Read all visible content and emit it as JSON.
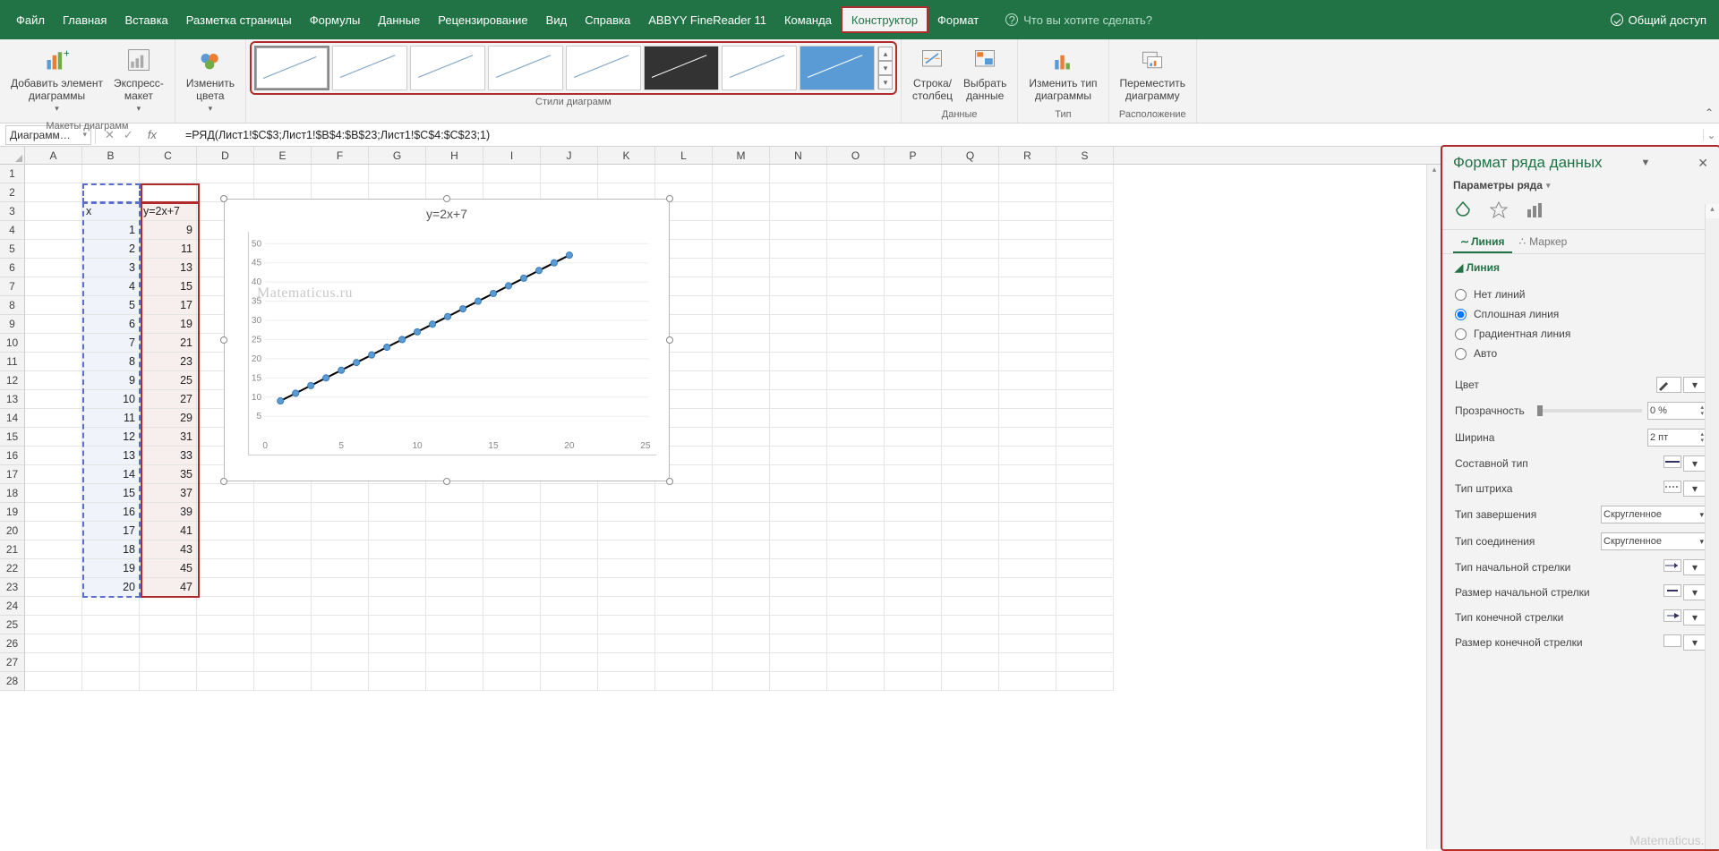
{
  "titlebar": {
    "tabs": [
      "Файл",
      "Главная",
      "Вставка",
      "Разметка страницы",
      "Формулы",
      "Данные",
      "Рецензирование",
      "Вид",
      "Справка",
      "ABBYY FineReader 11",
      "Команда",
      "Конструктор",
      "Формат"
    ],
    "active_tab_index": 11,
    "tell_me": "Что вы хотите сделать?",
    "share": "Общий доступ"
  },
  "ribbon": {
    "grp_layouts": "Макеты диаграмм",
    "add_element": "Добавить элемент\nдиаграммы",
    "quick_layout": "Экспресс-\nмакет",
    "change_colors": "Изменить\nцвета",
    "grp_styles": "Стили диаграмм",
    "grp_data": "Данные",
    "switch_rc": "Строка/\nстолбец",
    "select_data": "Выбрать\nданные",
    "grp_type": "Тип",
    "change_type": "Изменить тип\nдиаграммы",
    "grp_location": "Расположение",
    "move_chart": "Переместить\nдиаграмму"
  },
  "formula": {
    "namebox": "Диаграмм…",
    "text": "=РЯД(Лист1!$C$3;Лист1!$B$4:$B$23;Лист1!$C$4:$C$23;1)"
  },
  "columns": [
    "A",
    "B",
    "C",
    "D",
    "E",
    "F",
    "G",
    "H",
    "I",
    "J",
    "K",
    "L",
    "M",
    "N",
    "O",
    "P",
    "Q",
    "R",
    "S"
  ],
  "row_numbers": [
    1,
    2,
    3,
    4,
    5,
    6,
    7,
    8,
    9,
    10,
    11,
    12,
    13,
    14,
    15,
    16,
    17,
    18,
    19,
    20,
    21,
    22,
    23,
    24,
    25,
    26,
    27,
    28
  ],
  "table": {
    "header_b": "x",
    "header_c": "y=2x+7",
    "rows": [
      {
        "x": 1,
        "y": 9
      },
      {
        "x": 2,
        "y": 11
      },
      {
        "x": 3,
        "y": 13
      },
      {
        "x": 4,
        "y": 15
      },
      {
        "x": 5,
        "y": 17
      },
      {
        "x": 6,
        "y": 19
      },
      {
        "x": 7,
        "y": 21
      },
      {
        "x": 8,
        "y": 23
      },
      {
        "x": 9,
        "y": 25
      },
      {
        "x": 10,
        "y": 27
      },
      {
        "x": 11,
        "y": 29
      },
      {
        "x": 12,
        "y": 31
      },
      {
        "x": 13,
        "y": 33
      },
      {
        "x": 14,
        "y": 35
      },
      {
        "x": 15,
        "y": 37
      },
      {
        "x": 16,
        "y": 39
      },
      {
        "x": 17,
        "y": 41
      },
      {
        "x": 18,
        "y": 43
      },
      {
        "x": 19,
        "y": 45
      },
      {
        "x": 20,
        "y": 47
      }
    ]
  },
  "chart": {
    "title": "y=2x+7",
    "watermark": "Matematicus.ru",
    "watermark2": "Matematicus.ru"
  },
  "chart_data": {
    "type": "line",
    "title": "y=2x+7",
    "xlabel": "",
    "ylabel": "",
    "xlim": [
      0,
      25
    ],
    "ylim": [
      0,
      50
    ],
    "x_ticks": [
      0,
      5,
      10,
      15,
      20,
      25
    ],
    "y_ticks": [
      5,
      10,
      15,
      20,
      25,
      30,
      35,
      40,
      45,
      50
    ],
    "series": [
      {
        "name": "y=2x+7",
        "x": [
          1,
          2,
          3,
          4,
          5,
          6,
          7,
          8,
          9,
          10,
          11,
          12,
          13,
          14,
          15,
          16,
          17,
          18,
          19,
          20
        ],
        "y": [
          9,
          11,
          13,
          15,
          17,
          19,
          21,
          23,
          25,
          27,
          29,
          31,
          33,
          35,
          37,
          39,
          41,
          43,
          45,
          47
        ]
      }
    ]
  },
  "sidepanel": {
    "title": "Формат ряда данных",
    "subtitle": "Параметры ряда",
    "tab_line": "Линия",
    "tab_marker": "Маркер",
    "section_line": "Линия",
    "radio_none": "Нет линий",
    "radio_solid": "Сплошная линия",
    "radio_gradient": "Градиентная линия",
    "radio_auto": "Авто",
    "selected_radio": "solid",
    "prop_color": "Цвет",
    "prop_transparency": "Прозрачность",
    "transparency_val": "0 %",
    "prop_width": "Ширина",
    "width_val": "2 пт",
    "prop_compound": "Составной тип",
    "prop_dash": "Тип штриха",
    "prop_cap": "Тип завершения",
    "cap_val": "Скругленное",
    "prop_join": "Тип соединения",
    "join_val": "Скругленное",
    "prop_begin_arrow": "Тип начальной стрелки",
    "prop_begin_size": "Размер начальной стрелки",
    "prop_end_arrow": "Тип конечной стрелки",
    "prop_end_size": "Размер конечной стрелки"
  }
}
